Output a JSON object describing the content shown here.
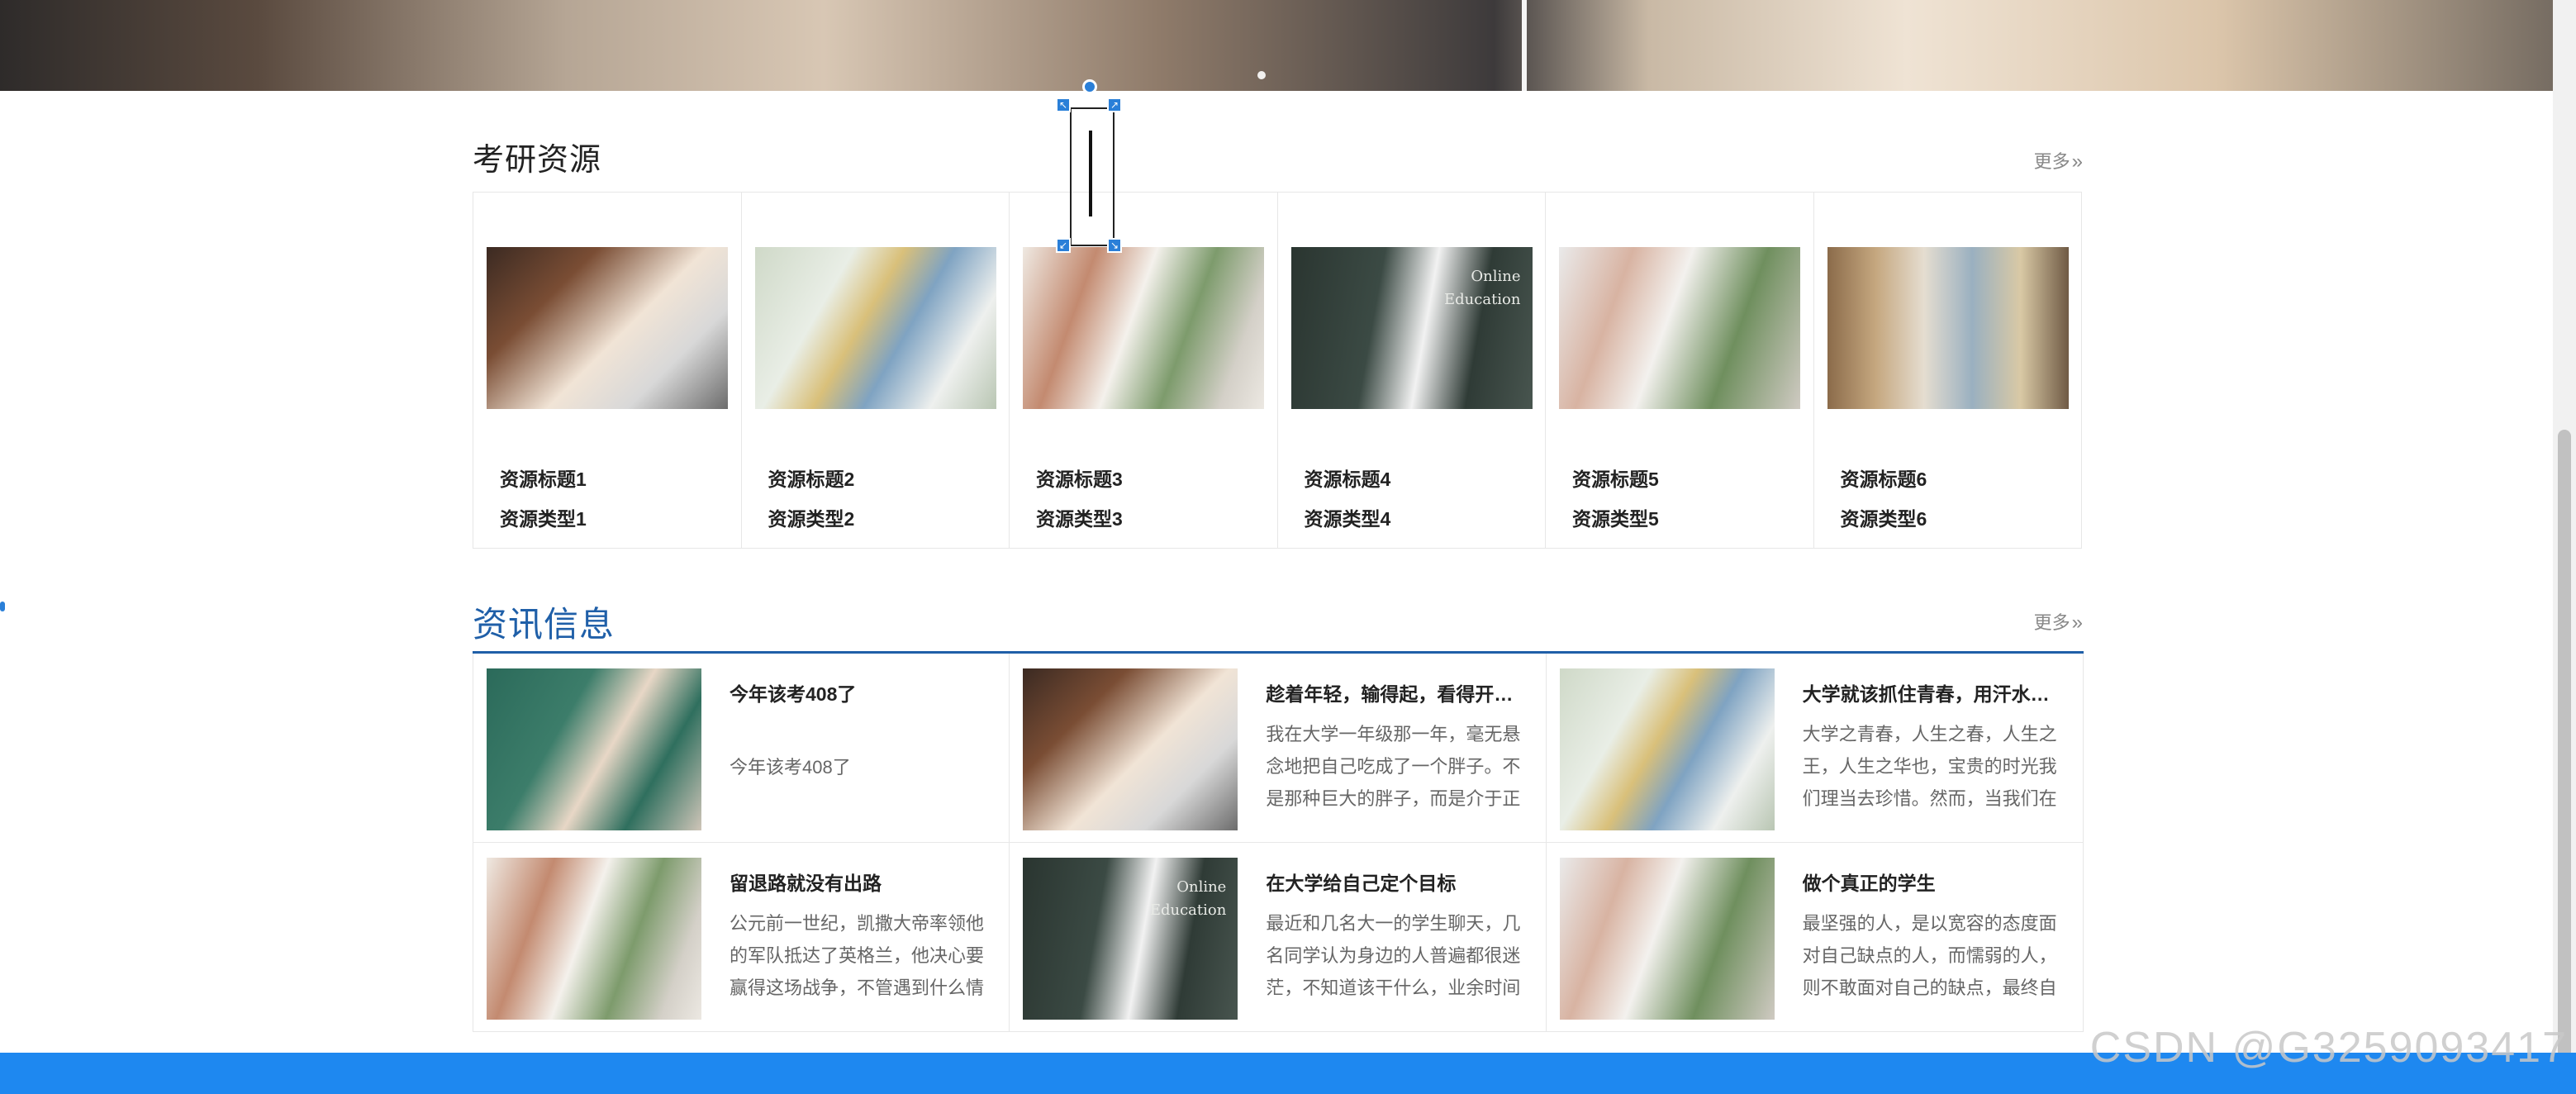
{
  "resources_section": {
    "title": "考研资源",
    "more_label": "更多",
    "more_arrows": "»",
    "items": [
      {
        "title": "资源标题1",
        "type": "资源类型1"
      },
      {
        "title": "资源标题2",
        "type": "资源类型2"
      },
      {
        "title": "资源标题3",
        "type": "资源类型3"
      },
      {
        "title": "资源标题4",
        "type": "资源类型4",
        "thumb_text_1": "Online",
        "thumb_text_2": "Education"
      },
      {
        "title": "资源标题5",
        "type": "资源类型5"
      },
      {
        "title": "资源标题6",
        "type": "资源类型6"
      }
    ]
  },
  "news_section": {
    "title": "资讯信息",
    "more_label": "更多",
    "more_arrows": "»",
    "items": [
      {
        "title": "今年该考408了",
        "summary": "今年该考408了"
      },
      {
        "title": "趁着年轻，输得起，看得开，...",
        "summary": "我在大学一年级那一年，毫无悬念地把自己吃成了一个胖子。不是那种巨大的胖子，而是介于正"
      },
      {
        "title": "大学就该抓住青春，用汗水实...",
        "summary": "大学之青春，人生之春，人生之王，人生之华也，宝贵的时光我们理当去珍惜。然而，当我们在"
      },
      {
        "title": "留退路就没有出路",
        "summary": "公元前一世纪，凯撒大帝率领他的军队抵达了英格兰，他决心要赢得这场战争，不管遇到什么情"
      },
      {
        "title": "在大学给自己定个目标",
        "summary": "最近和几名大一的学生聊天，几名同学认为身边的人普遍都很迷茫，不知道该干什么，业余时间",
        "thumb_text_1": "Online",
        "thumb_text_2": "Education"
      },
      {
        "title": "做个真正的学生",
        "summary": "最坚强的人，是以宽容的态度面对自己缺点的人，而懦弱的人，则不敢面对自己的缺点，最终自"
      }
    ]
  },
  "watermark": "CSDN @G3259093417",
  "colors": {
    "accent_blue": "#1f5fa8",
    "footer_blue": "#1e88f0",
    "handle_blue": "#2a7fd8"
  },
  "icons": [
    "rotate-handle-icon",
    "resize-handle-icon",
    "double-chevron-right-icon"
  ]
}
